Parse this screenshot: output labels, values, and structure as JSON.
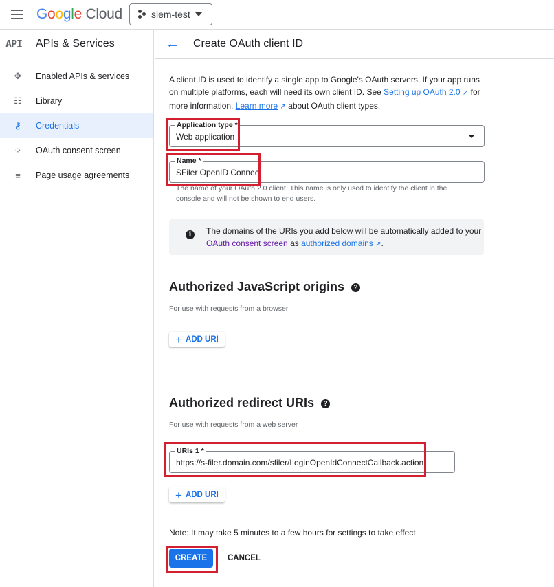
{
  "topbar": {
    "logo": {
      "G": "G",
      "o1": "o",
      "o2": "o",
      "g": "g",
      "l": "l",
      "e": "e",
      "cloud": "Cloud"
    },
    "project": "siem-test"
  },
  "sidebar": {
    "logo_text": "API",
    "title": "APIs & Services",
    "items": [
      {
        "label": "Enabled APIs & services",
        "icon": "enabled-apis-icon",
        "glyph": "✥",
        "active": false
      },
      {
        "label": "Library",
        "icon": "library-icon",
        "glyph": "☷",
        "active": false
      },
      {
        "label": "Credentials",
        "icon": "key-icon",
        "glyph": "⚷",
        "active": true
      },
      {
        "label": "OAuth consent screen",
        "icon": "consent-screen-icon",
        "glyph": "⁘",
        "active": false
      },
      {
        "label": "Page usage agreements",
        "icon": "settings-list-icon",
        "glyph": "≡",
        "active": false
      }
    ]
  },
  "header": {
    "title": "Create OAuth client ID",
    "back_icon": "←"
  },
  "intro": {
    "t1": "A client ID is used to identify a single app to Google's OAuth servers. If your app runs on multiple platforms, each will need its own client ID. See ",
    "link1": "Setting up OAuth 2.0",
    "t2": " for more information. ",
    "link2": "Learn more",
    "t3": " about OAuth client types.",
    "ext_icon": "↗"
  },
  "form": {
    "app_type": {
      "label": "Application type *",
      "value": "Web application"
    },
    "name": {
      "label": "Name *",
      "value": "SFiler OpenID Connect",
      "hint": "The name of your OAuth 2.0 client. This name is only used to identify the client in the console and will not be shown to end users."
    }
  },
  "info": {
    "icon": "i",
    "t1": "The domains of the URIs you add below will be automatically added to your ",
    "link1": "OAuth consent screen",
    "t2": " as ",
    "link2": "authorized domains",
    "t3": "."
  },
  "js_origins": {
    "title": "Authorized JavaScript origins",
    "help": "?",
    "subtitle": "For use with requests from a browser",
    "add_label": "ADD URI",
    "plus": "+"
  },
  "redirect_uris": {
    "title": "Authorized redirect URIs",
    "help": "?",
    "subtitle": "For use with requests from a web server",
    "uri1": {
      "label": "URIs 1 *",
      "value": "https://s-filer.domain.com/sfiler/LoginOpenIdConnectCallback.action"
    },
    "add_label": "ADD URI",
    "plus": "+"
  },
  "footer": {
    "note": "Note: It may take 5 minutes to a few hours for settings to take effect",
    "create": "CREATE",
    "cancel": "CANCEL"
  },
  "colors": {
    "accent": "#1a73e8",
    "highlight": "#d32030",
    "active_bg": "#e8f0fe"
  }
}
